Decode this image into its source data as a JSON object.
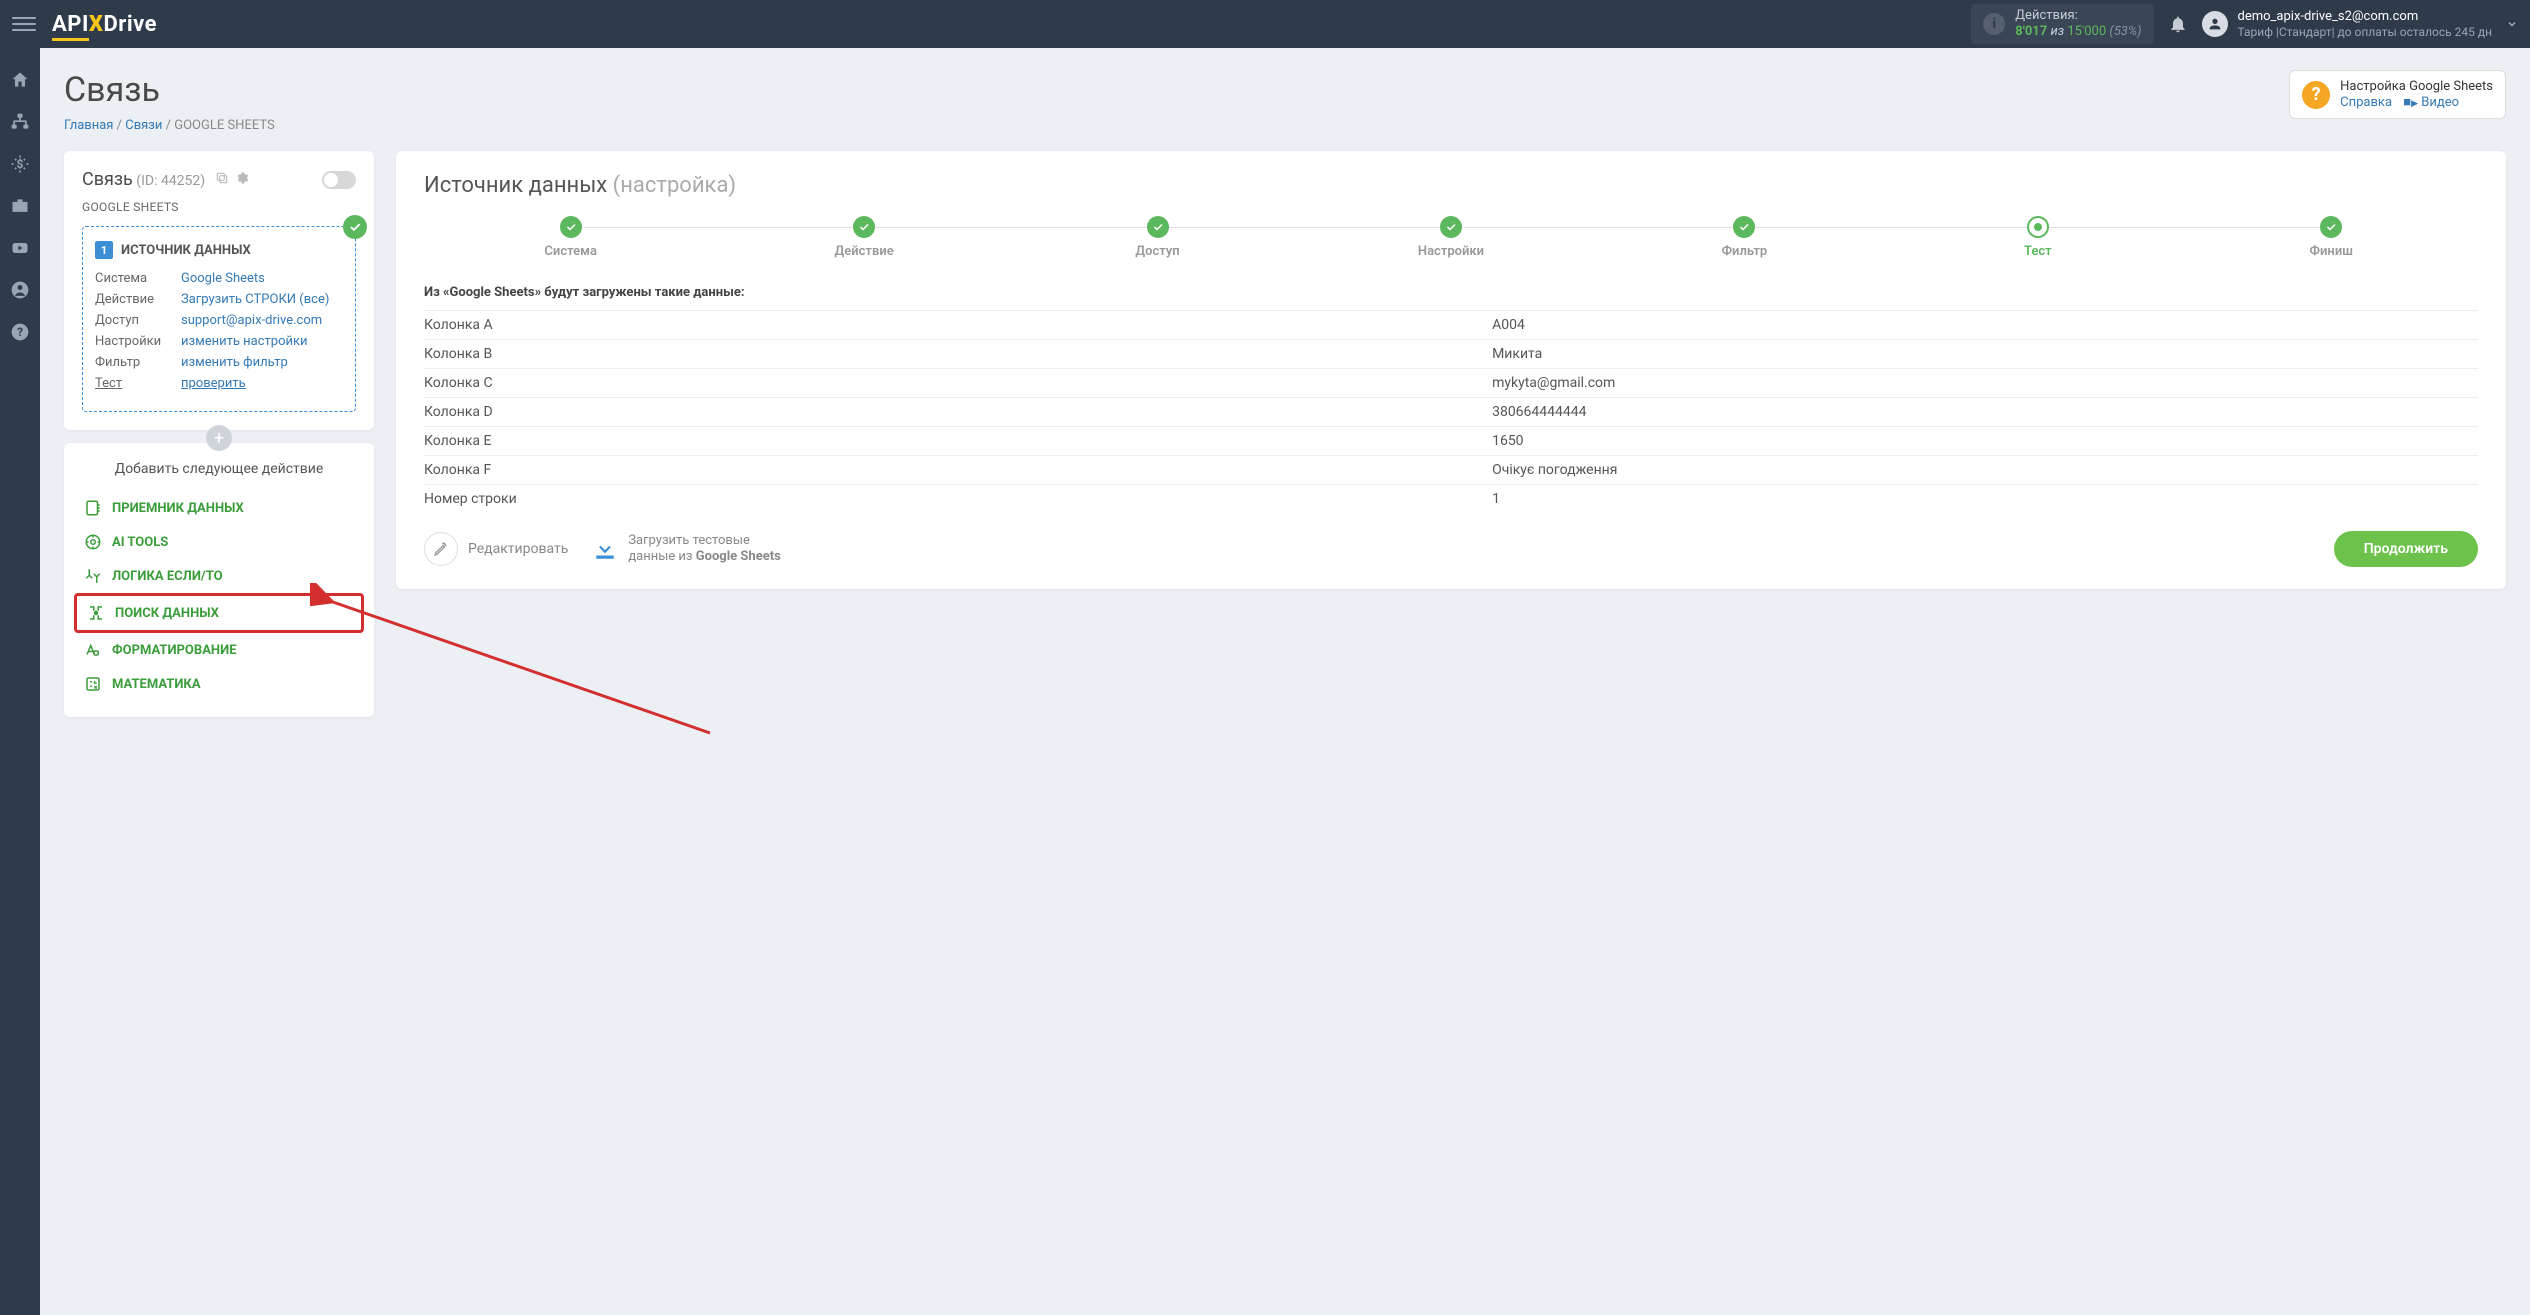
{
  "topbar": {
    "logo_pre": "API",
    "logo_x": "X",
    "logo_post": "Drive",
    "actions_label": "Действия:",
    "actions_used": "8'017",
    "actions_sep": "из",
    "actions_total": "15'000",
    "actions_pct": "(53%)",
    "user_email": "demo_apix-drive_s2@com.com",
    "user_plan": "Тариф |Стандарт| до оплаты осталось 245 дн"
  },
  "page": {
    "title": "Связь",
    "bc_home": "Главная",
    "bc_links": "Связи",
    "bc_current": "GOOGLE SHEETS"
  },
  "help": {
    "title": "Настройка Google Sheets",
    "link1": "Справка",
    "link2": "Видео"
  },
  "conn": {
    "title": "Связь",
    "id": "(ID: 44252)",
    "subtitle": "GOOGLE SHEETS"
  },
  "source": {
    "badge_num": "1",
    "header": "ИСТОЧНИК ДАННЫХ",
    "rows": [
      {
        "k": "Система",
        "v": "Google Sheets"
      },
      {
        "k": "Действие",
        "v": "Загрузить СТРОКИ (все)"
      },
      {
        "k": "Доступ",
        "v": "support@apix-drive.com"
      },
      {
        "k": "Настройки",
        "v": "изменить настройки"
      },
      {
        "k": "Фильтр",
        "v": "изменить фильтр"
      },
      {
        "k": "Тест",
        "v": "проверить",
        "ku": true,
        "vu": true
      }
    ]
  },
  "add_action": {
    "header": "Добавить следующее действие",
    "items": [
      {
        "label": "ПРИЕМНИК ДАННЫХ",
        "name": "action-receiver"
      },
      {
        "label": "AI TOOLS",
        "name": "action-ai-tools"
      },
      {
        "label": "ЛОГИКА ЕСЛИ/ТО",
        "name": "action-logic"
      },
      {
        "label": "ПОИСК ДАННЫХ",
        "name": "action-data-search",
        "highlight": true
      },
      {
        "label": "ФОРМАТИРОВАНИЕ",
        "name": "action-format"
      },
      {
        "label": "МАТЕМАТИКА",
        "name": "action-math"
      }
    ]
  },
  "main": {
    "title": "Источник данных",
    "title_sub": "(настройка)",
    "steps": [
      {
        "label": "Система"
      },
      {
        "label": "Действие"
      },
      {
        "label": "Доступ"
      },
      {
        "label": "Настройки"
      },
      {
        "label": "Фильтр"
      },
      {
        "label": "Тест",
        "current": true
      },
      {
        "label": "Финиш"
      }
    ],
    "intro": "Из «Google Sheets» будут загружены такие данные:",
    "rows": [
      {
        "k": "Колонка A",
        "v": "A004"
      },
      {
        "k": "Колонка B",
        "v": "Микита"
      },
      {
        "k": "Колонка C",
        "v": "mykyta@gmail.com"
      },
      {
        "k": "Колонка D",
        "v": "380664444444"
      },
      {
        "k": "Колонка E",
        "v": "1650"
      },
      {
        "k": "Колонка F",
        "v": "Очікує погодження"
      },
      {
        "k": "Номер строки",
        "v": "1"
      }
    ],
    "edit": "Редактировать",
    "download_l1": "Загрузить тестовые",
    "download_l2_pre": "данные из ",
    "download_l2_bold": "Google Sheets",
    "continue": "Продолжить"
  }
}
